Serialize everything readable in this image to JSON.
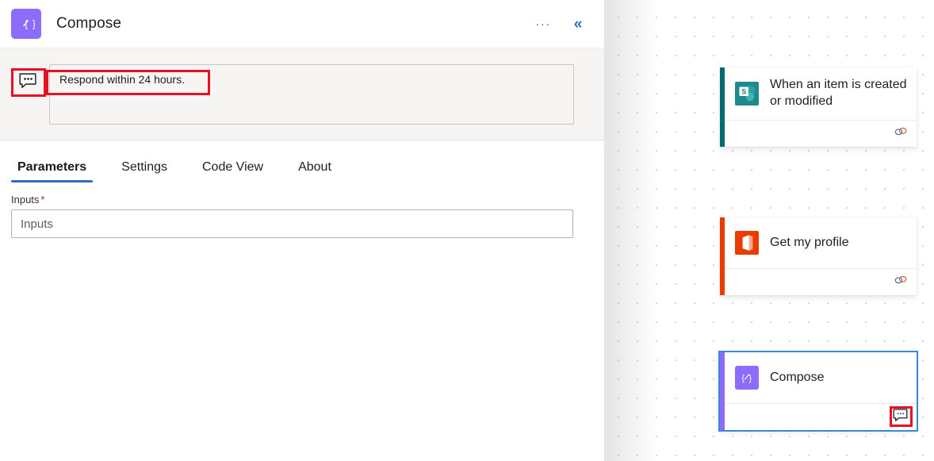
{
  "panel": {
    "icon_name": "compose-icon",
    "title": "Compose",
    "actions": [
      {
        "name": "more-options-button",
        "label": "···"
      },
      {
        "name": "collapse-panel-button",
        "label": "«"
      }
    ],
    "comment": {
      "icon_name": "comment-icon",
      "text": "Respond within 24 hours."
    },
    "tabs": [
      {
        "label": "Parameters",
        "active": true
      },
      {
        "label": "Settings",
        "active": false
      },
      {
        "label": "Code View",
        "active": false
      },
      {
        "label": "About",
        "active": false
      }
    ],
    "fields": [
      {
        "label": "Inputs",
        "required_marker": "*",
        "placeholder": "Inputs",
        "value": ""
      }
    ]
  },
  "canvas": {
    "nodes": [
      {
        "id": "when-an-item-is-created-or-modified",
        "title": "When an item is created or modified",
        "connector_icon": "sharepoint-icon",
        "accent_color": "#036C70",
        "selected": false,
        "footer_icon": "link-icon"
      },
      {
        "id": "get-my-profile",
        "title": "Get my profile",
        "connector_icon": "office365-icon",
        "accent_color": "#EB3C00",
        "selected": false,
        "footer_icon": "link-icon"
      },
      {
        "id": "compose",
        "title": "Compose",
        "connector_icon": "compose-icon",
        "accent_color": "#8C6CFA",
        "selected": true,
        "footer_icon": "comment-icon",
        "footer_icon_highlighted": true
      }
    ],
    "add_buttons": [
      {
        "name": "insert-step-button-1",
        "label": "+"
      },
      {
        "name": "insert-step-button-2",
        "label": "+"
      },
      {
        "name": "insert-step-button-3",
        "label": "+"
      }
    ]
  },
  "colors": {
    "accent_blue": "#2b6cc4",
    "selection_blue": "#3c87d6",
    "highlight_red": "#e81123",
    "sharepoint_teal": "#036C70",
    "office_orange": "#EB3C00",
    "compose_purple": "#8C6CFA"
  }
}
